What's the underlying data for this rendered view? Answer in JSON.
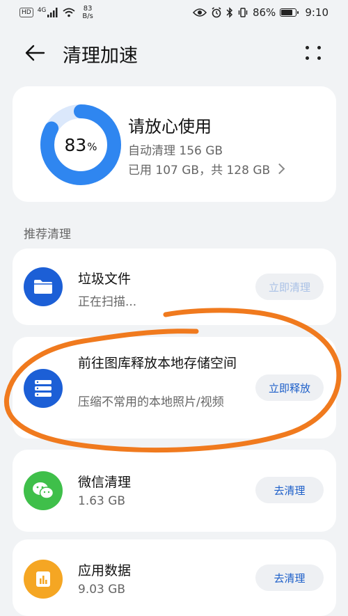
{
  "status_bar": {
    "hd": "HD",
    "signal_gen": "4G",
    "net_speed_value": "83",
    "net_speed_unit": "B/s",
    "battery_percent": "86%",
    "battery_level": 0.86,
    "time": "9:10"
  },
  "app_bar": {
    "title": "清理加速"
  },
  "summary": {
    "usage_percent_value": "83",
    "usage_percent_unit": "%",
    "usage_fraction": 0.83,
    "title": "请放心使用",
    "auto_clean": "自动清理 156 GB",
    "storage": "已用 107 GB，共 128 GB"
  },
  "section_title": "推荐清理",
  "items": [
    {
      "title": "垃圾文件",
      "subtitle": "正在扫描...",
      "button": "立即清理",
      "icon": "folder-icon",
      "icon_color": "#1c5fd6"
    },
    {
      "title": "前往图库释放本地存储空间",
      "subtitle": "压缩不常用的本地照片/视频",
      "button": "立即释放",
      "icon": "storage-stack-icon",
      "icon_color": "#1c5fd6"
    },
    {
      "title": "微信清理",
      "subtitle": "1.63 GB",
      "button": "去清理",
      "icon": "wechat-icon",
      "icon_color": "#3fbf4a"
    },
    {
      "title": "应用数据",
      "subtitle": "9.03 GB",
      "button": "去清理",
      "icon": "bar-chart-icon",
      "icon_color": "#f5a623"
    }
  ],
  "colors": {
    "accent_blue": "#1d5fc9",
    "ring_blue": "#2f86f0",
    "ring_track": "#dbe8fb",
    "annotation_orange": "#f07a1e",
    "background": "#f1f3f5"
  }
}
